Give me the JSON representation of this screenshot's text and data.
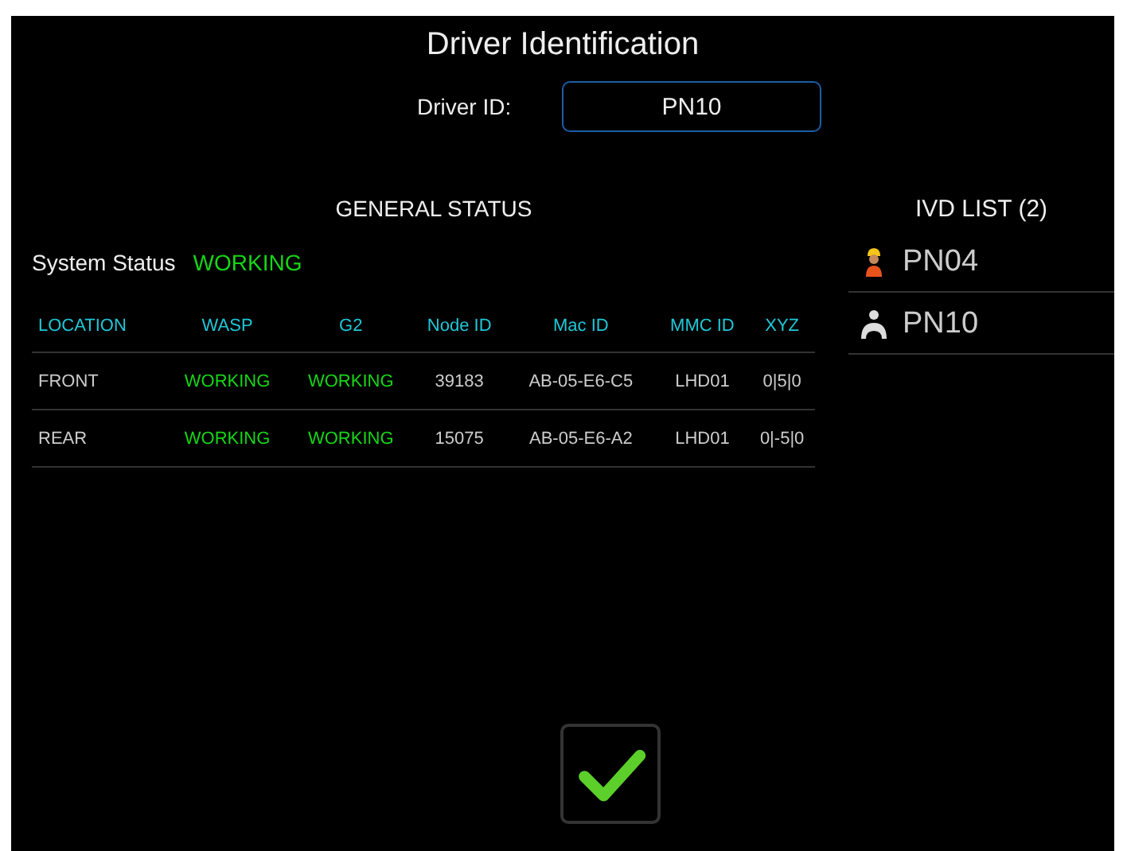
{
  "title": "Driver Identification",
  "driver_id": {
    "label": "Driver ID:",
    "value": "PN10"
  },
  "general_status": {
    "heading": "GENERAL STATUS",
    "system_status": {
      "label": "System Status",
      "value": "WORKING"
    },
    "table": {
      "columns": [
        {
          "label": "LOCATION",
          "kind": "text"
        },
        {
          "label": "WASP",
          "kind": "status"
        },
        {
          "label": "G2",
          "kind": "status"
        },
        {
          "label": "Node ID",
          "kind": "text"
        },
        {
          "label": "Mac ID",
          "kind": "text"
        },
        {
          "label": "MMC ID",
          "kind": "text"
        },
        {
          "label": "XYZ",
          "kind": "text"
        }
      ],
      "rows": [
        [
          "FRONT",
          "WORKING",
          "WORKING",
          "39183",
          "AB-05-E6-C5",
          "LHD01",
          "0|5|0"
        ],
        [
          "REAR",
          "WORKING",
          "WORKING",
          "15075",
          "AB-05-E6-A2",
          "LHD01",
          "0|-5|0"
        ]
      ]
    }
  },
  "ivd_list": {
    "heading": "IVD LIST (2)",
    "items": [
      {
        "label": "PN04",
        "kind": "worker"
      },
      {
        "label": "PN10",
        "kind": "driver"
      }
    ]
  },
  "confirm_button": {
    "kind": "check"
  }
}
